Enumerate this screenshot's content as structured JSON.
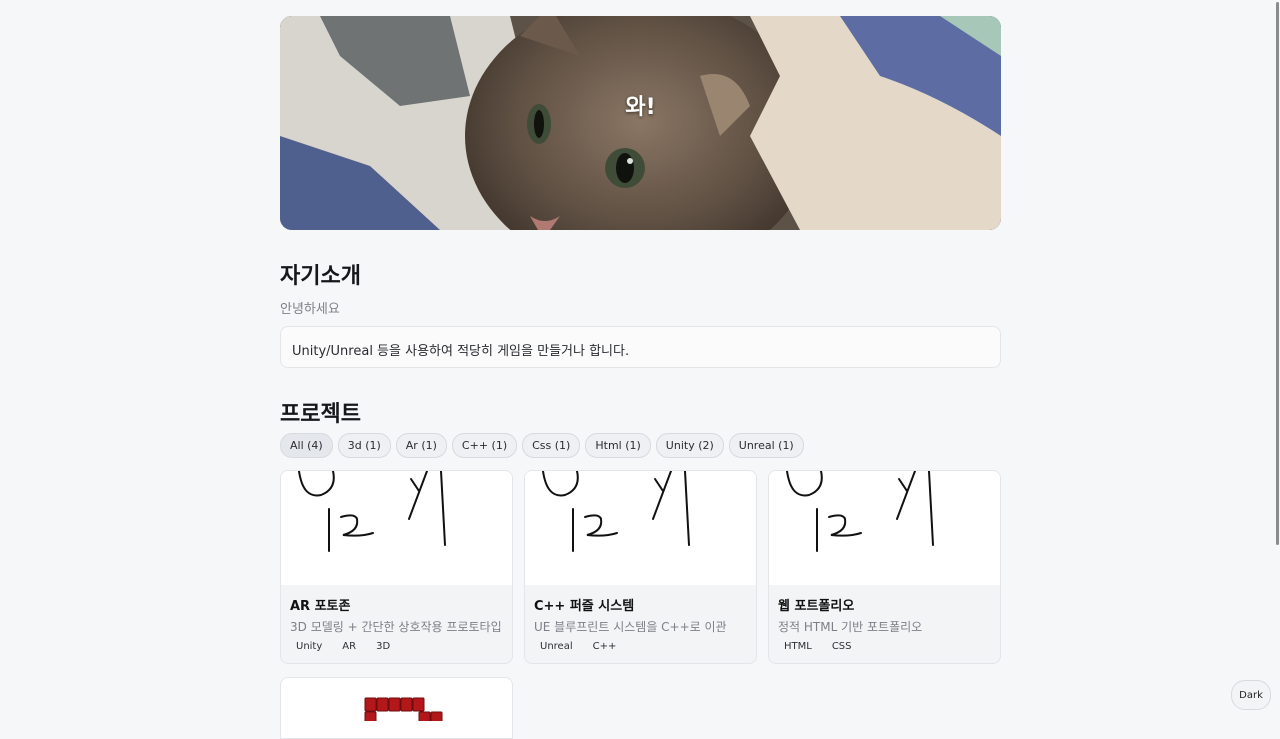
{
  "hero": {
    "title": "와!"
  },
  "about": {
    "heading": "자기소개",
    "subtitle": "안녕하세요",
    "body": "Unity/Unreal 등을 사용하여 적당히 게임을 만들거나 합니다."
  },
  "projects": {
    "heading": "프로젝트",
    "filters": [
      "All (4)",
      "3d (1)",
      "Ar (1)",
      "C++ (1)",
      "Css (1)",
      "Html (1)",
      "Unity (2)",
      "Unreal (1)"
    ],
    "cards": [
      {
        "title": "AR 포토존",
        "description": "3D 모델링 + 간단한 상호작용 프로토타입",
        "tags": [
          "Unity",
          "AR",
          "3D"
        ]
      },
      {
        "title": "C++ 퍼즐 시스템",
        "description": "UE 블루프린트 시스템을 C++로 이관",
        "tags": [
          "Unreal",
          "C++"
        ]
      },
      {
        "title": "웹 포트폴리오",
        "description": "정적 HTML 기반 포트폴리오",
        "tags": [
          "HTML",
          "CSS"
        ]
      }
    ]
  },
  "theme_toggle": {
    "label": "Dark"
  },
  "colors": {
    "background": "#f6f7f9",
    "card": "#f3f4f6",
    "border": "#e3e5e9",
    "thumb_pixel_red": "#b3171a"
  }
}
